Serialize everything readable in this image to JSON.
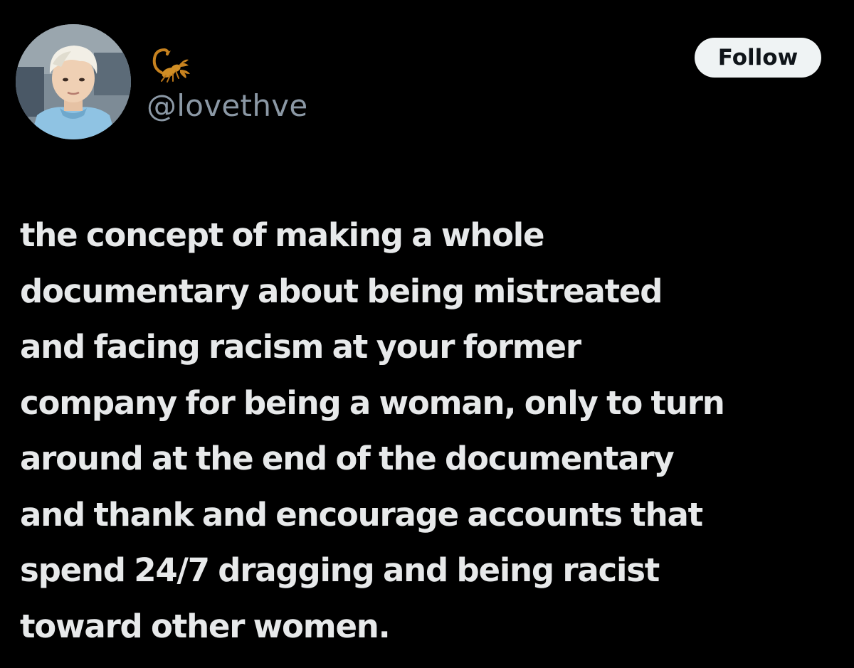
{
  "post": {
    "author": {
      "handle": "@lovethve",
      "display_name_icon": "scorpion-emoji",
      "avatar_icon": "profile-photo"
    },
    "follow_button_label": "Follow",
    "text_lines": [
      "the concept of making a whole",
      "documentary about being mistreated",
      "and facing racism at your former",
      "company for being a woman, only to turn",
      "around at the end of the documentary",
      "and thank and encourage accounts that",
      "spend 24/7 dragging and being racist",
      "toward other women."
    ]
  },
  "colors": {
    "background": "#000000",
    "text": "#e7e9ea",
    "handle": "#8b98a5",
    "button_bg": "#eff3f4",
    "button_text": "#0f1419"
  }
}
